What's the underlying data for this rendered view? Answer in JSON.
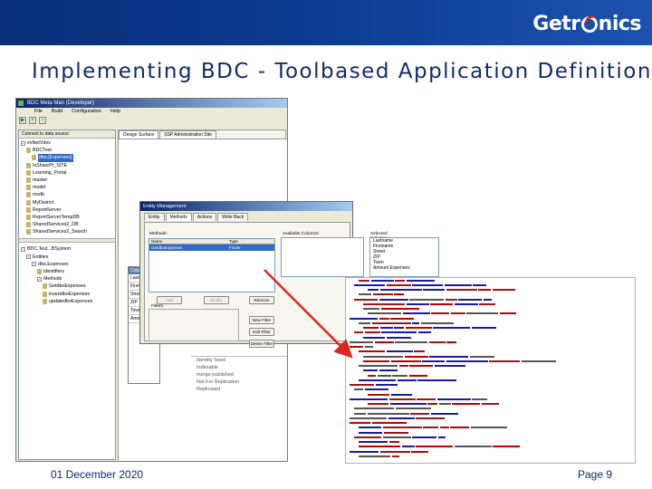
{
  "header": {
    "logo_text_pre": "Getr",
    "logo_text_post": "nics"
  },
  "slide": {
    "title": "Implementing BDC - Toolbased Application Definition",
    "date": "01 December 2020",
    "page": "Page 9"
  },
  "app_window": {
    "title": "BDC Meta Man (Developer)",
    "menu": [
      "File",
      "Build",
      "Configuration",
      "Help"
    ],
    "left_pane_header": "Connect to data source:",
    "tree_top": [
      {
        "label": "exNetVdev",
        "kind": "box",
        "indent": 0
      },
      {
        "label": "BDCTest",
        "kind": "db",
        "indent": 1
      },
      {
        "label": "dbo.[Expenses]",
        "kind": "db",
        "indent": 2,
        "selected": true
      },
      {
        "label": "IsSharePt_SITE",
        "kind": "db",
        "indent": 1
      },
      {
        "label": "Learning_Portal",
        "kind": "db",
        "indent": 1
      },
      {
        "label": "master",
        "kind": "db",
        "indent": 1
      },
      {
        "label": "model",
        "kind": "db",
        "indent": 1
      },
      {
        "label": "msdb",
        "kind": "db",
        "indent": 1
      },
      {
        "label": "MyDistrict",
        "kind": "db",
        "indent": 1
      },
      {
        "label": "ReportServer",
        "kind": "db",
        "indent": 1
      },
      {
        "label": "ReportServerTempDB",
        "kind": "db",
        "indent": 1
      },
      {
        "label": "SharedServices2_DB",
        "kind": "db",
        "indent": 1
      },
      {
        "label": "SharedServices2_Search",
        "kind": "db",
        "indent": 1
      }
    ],
    "tree_bottom": [
      {
        "label": "BDC.Test...BSystem",
        "kind": "box",
        "indent": 0
      },
      {
        "label": "Entities",
        "kind": "box",
        "indent": 1
      },
      {
        "label": "dbo.Expenses",
        "kind": "box",
        "indent": 2
      },
      {
        "label": "Identifiers",
        "kind": "db",
        "indent": 3
      },
      {
        "label": "Methods",
        "kind": "box",
        "indent": 3
      },
      {
        "label": "GetdboExpenses",
        "kind": "db",
        "indent": 4
      },
      {
        "label": "insertdboExpenses",
        "kind": "db",
        "indent": 4
      },
      {
        "label": "updatedboExpenses",
        "kind": "db",
        "indent": 4
      }
    ],
    "tabs": [
      "Design Surface",
      "SSP Administration Site"
    ],
    "entity_box": {
      "header": "Colu",
      "rows": [
        "Lastnam",
        "Firstnam",
        "Street",
        "ZIP",
        "Town",
        "Amount"
      ]
    },
    "properties": [
      "Identity Seed",
      "Indexable",
      "merge-published",
      "Not For Replication",
      "Replicated"
    ]
  },
  "dialog": {
    "title": "Entity Management",
    "tabs": [
      "Entity",
      "Methods",
      "Actions",
      "Write Back"
    ],
    "methods_label": "Methods:",
    "columns": [
      "Name",
      "Type"
    ],
    "method_row": [
      "GetdboExpenses",
      "Finder"
    ],
    "add_label": "Add",
    "modify_label": "Modify",
    "remove_label": "Remove",
    "filters_label": "Filters",
    "new_filter_label": "New Filter",
    "edit_filter_label": "Edit Filter",
    "delete_filter_label": "Delete Filter",
    "available_label": "Available Columns",
    "selected_label": "Selected Columns",
    "selected_columns": [
      "Lastname",
      "Firstname",
      "Street",
      "ZIP",
      "Town",
      "Amount Expenses"
    ]
  },
  "colors": {
    "header_bg": "#0b2f7a",
    "title_text": "#0d2b6e",
    "arrow": "#e0261b",
    "selection": "#316ac5"
  }
}
